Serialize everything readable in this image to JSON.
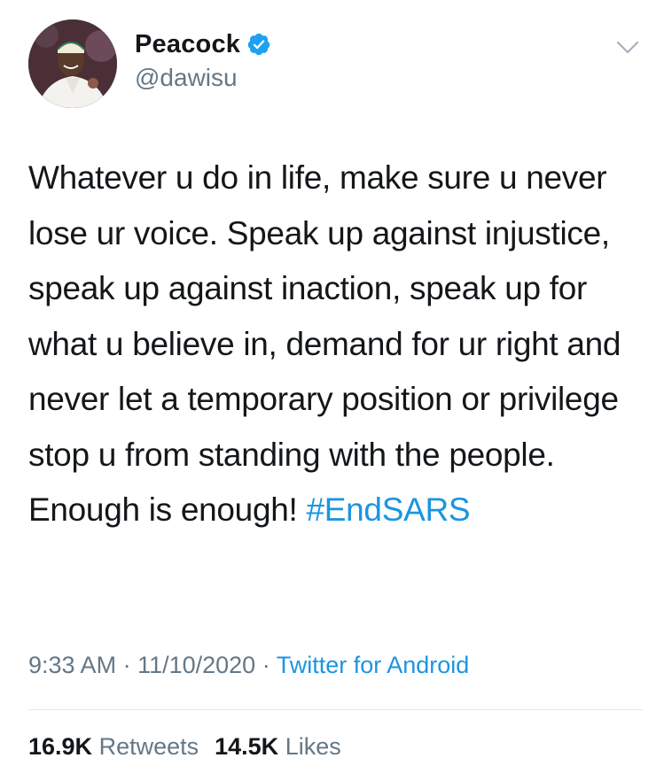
{
  "author": {
    "display_name": "Peacock",
    "handle": "@dawisu",
    "verified": true,
    "avatar_icon": "profile-photo"
  },
  "tweet": {
    "text": "Whatever u do in life, make sure u never lose ur voice. Speak up against injustice, speak up against inaction, speak up for what u believe in, demand for ur right and never let a temporary position or privilege stop u from standing with the people. Enough is enough! ",
    "hashtag": "#EndSARS"
  },
  "meta": {
    "time": "9:33 AM",
    "separator": " · ",
    "date": "11/10/2020",
    "source": "Twitter for Android"
  },
  "stats": {
    "retweets_count": "16.9K",
    "retweets_label": " Retweets",
    "likes_count": "14.5K",
    "likes_label": " Likes"
  },
  "colors": {
    "link": "#1b95e0",
    "secondary_text": "#657786",
    "primary_text": "#14171a",
    "divider": "#e1e8ed"
  }
}
